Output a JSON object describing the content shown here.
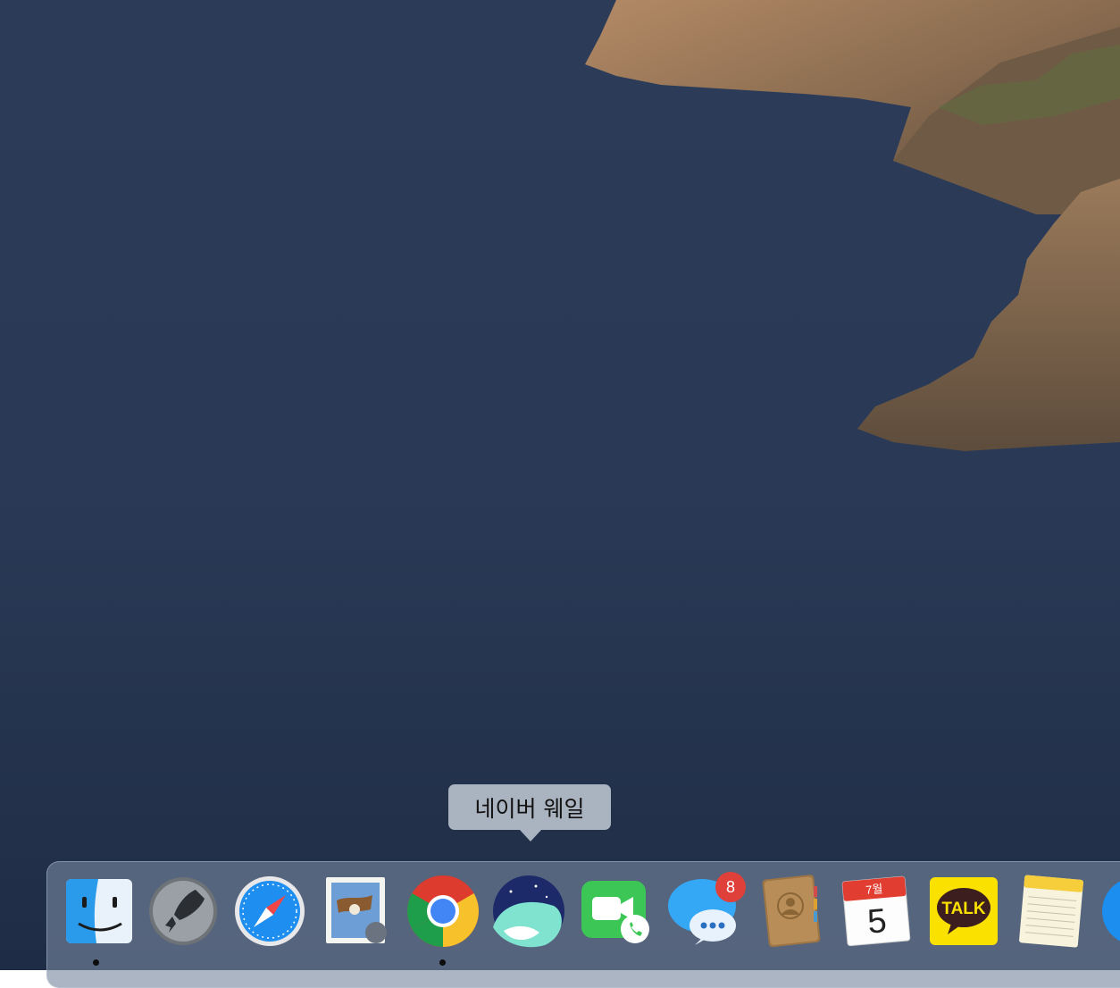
{
  "tooltip": {
    "text": "네이버 웨일"
  },
  "dock": {
    "apps": [
      {
        "id": "finder",
        "name": "finder-icon",
        "running": true
      },
      {
        "id": "launchpad",
        "name": "launchpad-icon",
        "running": false
      },
      {
        "id": "safari",
        "name": "safari-icon",
        "running": false
      },
      {
        "id": "mail",
        "name": "mail-icon",
        "running": false
      },
      {
        "id": "chrome",
        "name": "chrome-icon",
        "running": true
      },
      {
        "id": "whale",
        "name": "naver-whale-icon",
        "running": false
      },
      {
        "id": "facetime",
        "name": "facetime-icon",
        "running": false
      },
      {
        "id": "messages",
        "name": "messages-icon",
        "running": false,
        "badge": "8"
      },
      {
        "id": "contacts",
        "name": "contacts-icon",
        "running": false
      },
      {
        "id": "calendar",
        "name": "calendar-icon",
        "running": false,
        "month": "7월",
        "day": "5"
      },
      {
        "id": "kakaotalk",
        "name": "kakaotalk-icon",
        "running": false,
        "label": "TALK"
      },
      {
        "id": "notes",
        "name": "notes-icon",
        "running": false
      },
      {
        "id": "appstore",
        "name": "app-store-icon",
        "running": false
      }
    ]
  },
  "colors": {
    "sea": "#2b3a55",
    "cliff": "#8a6a4c",
    "dock": "#7888a0",
    "badge": "#e0403a"
  }
}
